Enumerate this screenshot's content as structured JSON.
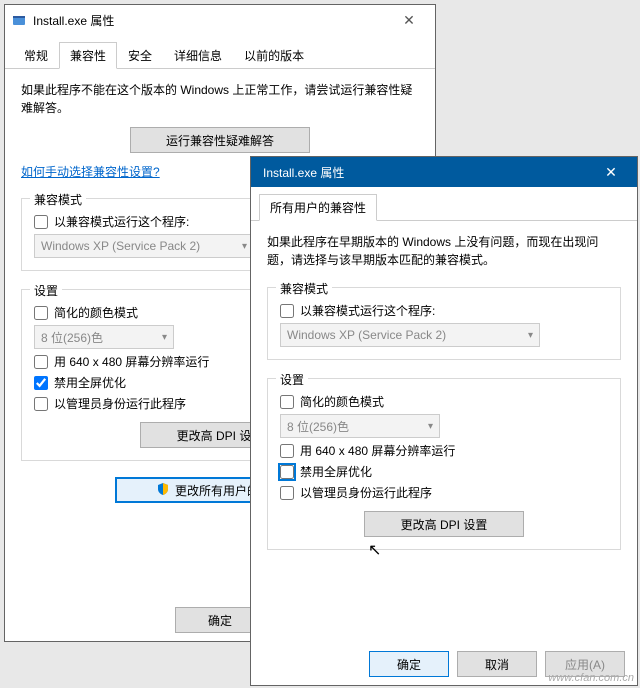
{
  "win1": {
    "title": "Install.exe 属性",
    "tabs": [
      "常规",
      "兼容性",
      "安全",
      "详细信息",
      "以前的版本"
    ],
    "active_tab_index": 1,
    "intro": "如果此程序不能在这个版本的 Windows 上正常工作，请尝试运行兼容性疑难解答。",
    "troubleshoot_btn": "运行兼容性疑难解答",
    "manual_link": "如何手动选择兼容性设置?",
    "compat_legend": "兼容模式",
    "compat_checkbox": "以兼容模式运行这个程序:",
    "compat_select": "Windows XP (Service Pack 2)",
    "settings_legend": "设置",
    "reduced_color": "简化的颜色模式",
    "color_select": "8 位(256)色",
    "res_640": "用 640 x 480 屏幕分辨率运行",
    "disable_fullscreen": "禁用全屏优化",
    "run_as_admin": "以管理员身份运行此程序",
    "dpi_btn": "更改高 DPI 设置",
    "all_users_btn": "更改所有用户的设置",
    "ok": "确定"
  },
  "win2": {
    "title": "Install.exe 属性",
    "tabs": [
      "所有用户的兼容性"
    ],
    "active_tab_index": 0,
    "intro": "如果此程序在早期版本的 Windows 上没有问题，而现在出现问题，请选择与该早期版本匹配的兼容模式。",
    "compat_legend": "兼容模式",
    "compat_checkbox": "以兼容模式运行这个程序:",
    "compat_select": "Windows XP (Service Pack 2)",
    "settings_legend": "设置",
    "reduced_color": "简化的颜色模式",
    "color_select": "8 位(256)色",
    "res_640": "用 640 x 480 屏幕分辨率运行",
    "disable_fullscreen": "禁用全屏优化",
    "run_as_admin": "以管理员身份运行此程序",
    "dpi_btn": "更改高 DPI 设置",
    "ok": "确定",
    "cancel": "取消",
    "apply": "应用(A)"
  },
  "watermark": "www.cfan.com.cn"
}
